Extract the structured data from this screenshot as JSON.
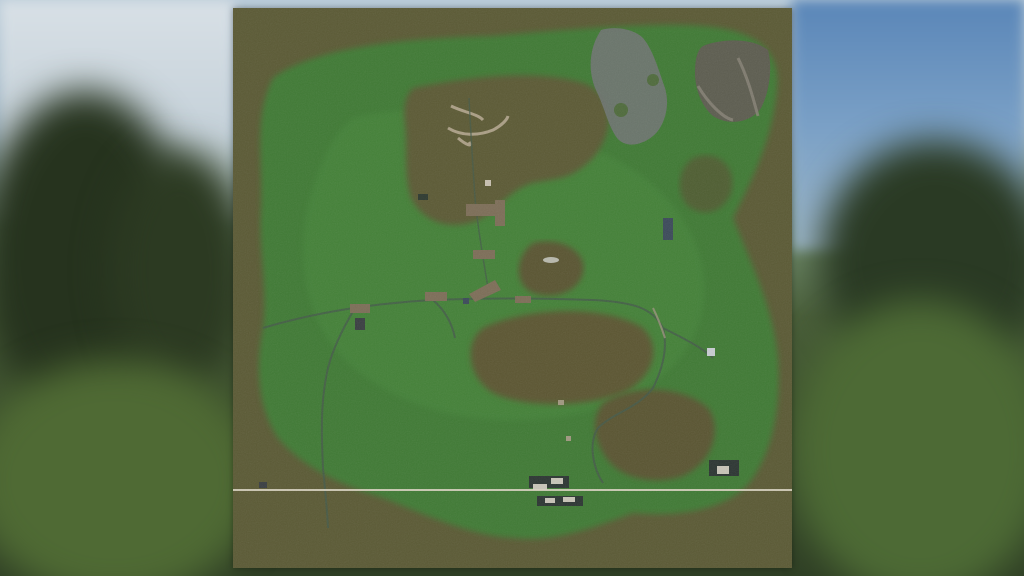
{
  "colors": {
    "dirt": "#5b5a35",
    "dirt_dark": "#514c2c",
    "grass": "#3f7a34",
    "grass_light": "#4a8a3c",
    "rock": "#6e7470",
    "road": "#455a4a",
    "building": "#7d6e58",
    "boundary_line": "#d8d2c0"
  },
  "scene": {
    "background": "blurred-forest-scene",
    "map_style": "satellite-terrain-overview"
  },
  "map": {
    "features": [
      "grass-area",
      "dirt-patch",
      "rock-quarry",
      "road",
      "farm-building",
      "boundary-line"
    ]
  }
}
